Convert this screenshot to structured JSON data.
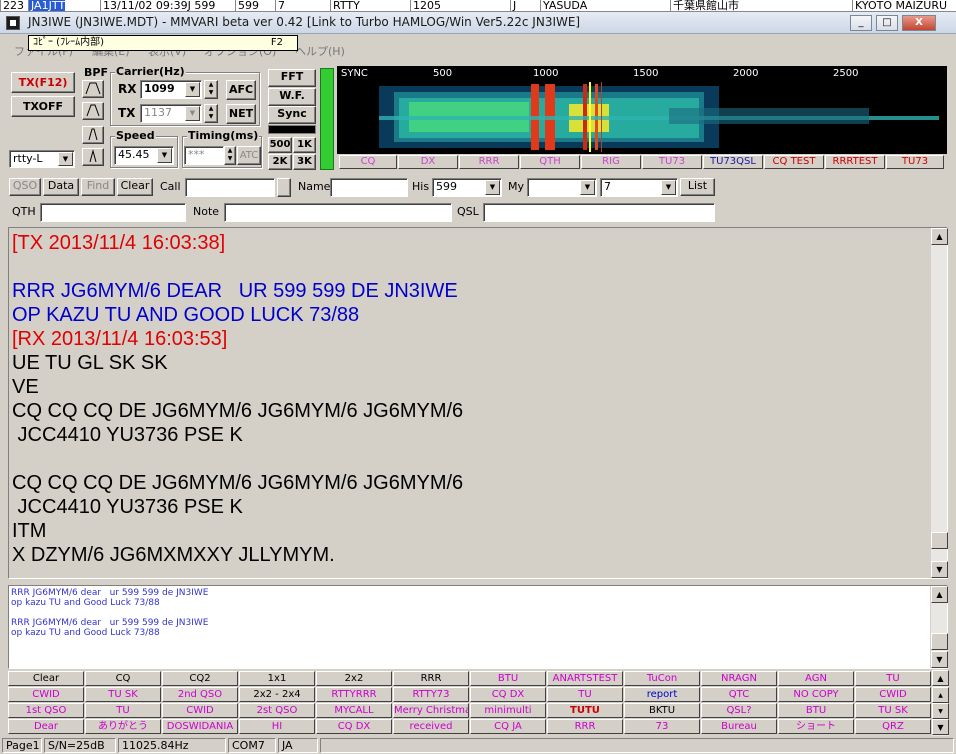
{
  "background_log": [
    "223",
    "JA1JTT",
    "13/11/02 09:39J 599",
    "599",
    "7",
    "RTTY",
    "1205",
    "J",
    "YASUDA",
    "千葉県館山市",
    "KYOTO MAIZURU"
  ],
  "window": {
    "title": "JN3IWE (JN3IWE.MDT) - MMVARI beta ver 0.42 [Link to Turbo HAMLOG/Win Ver5.22c JN3IWE]",
    "controls": [
      "_",
      "□",
      "X"
    ]
  },
  "menu": [
    "ファイル(F)",
    "編集(E)",
    "表示(V)",
    "オプション(O)",
    "ヘルプ(H)"
  ],
  "tooltip": {
    "text": "ｺﾋﾟｰ (ﾌﾚｰﾑ内部)",
    "key": "F2"
  },
  "left_panel": {
    "tx_button": "TX(F12)",
    "txoff_button": "TXOFF",
    "bpf_label": "BPF",
    "mode_value": "rtty-L",
    "carrier_label": "Carrier(Hz)",
    "rx_label": "RX",
    "rx_value": "1099",
    "tx_label": "TX",
    "tx_value": "1137",
    "afc_button": "AFC",
    "net_button": "NET",
    "speed_label": "Speed",
    "speed_value": "45.45",
    "timing_label": "Timing(ms)",
    "timing_value": "***",
    "atc_button": "ATC",
    "fft_button": "FFT",
    "wf_button": "W.F.",
    "sync_button": "Sync",
    "btn_500": "500",
    "btn_1k": "1K",
    "btn_2k": "2K",
    "btn_3k": "3K"
  },
  "waterfall": {
    "sync_label": "SYNC",
    "scale": [
      "500",
      "1000",
      "1500",
      "2000",
      "2500"
    ],
    "macros": [
      {
        "label": "CQ",
        "color": "#cc44cc"
      },
      {
        "label": "DX",
        "color": "#cc44cc"
      },
      {
        "label": "RRR",
        "color": "#cc44cc"
      },
      {
        "label": "QTH",
        "color": "#cc44cc"
      },
      {
        "label": "RIG",
        "color": "#cc44cc"
      },
      {
        "label": "TU73",
        "color": "#cc44cc"
      },
      {
        "label": "TU73QSL",
        "color": "#1a1aa0"
      },
      {
        "label": "CQ TEST",
        "color": "#cc0000"
      },
      {
        "label": "RRRTEST",
        "color": "#cc0000"
      },
      {
        "label": "TU73",
        "color": "#cc0000"
      }
    ]
  },
  "log_bar": {
    "qso_button": "QSO",
    "data_button": "Data",
    "find_button": "Find",
    "clear_button": "Clear",
    "call_label": "Call",
    "call_value": "",
    "name_label": "Name",
    "name_value": "",
    "his_label": "His",
    "his_value": "599",
    "my_label": "My",
    "my_value": "",
    "band_value": "7",
    "list_button": "List",
    "qth_label": "QTH",
    "note_label": "Note",
    "qsl_label": "QSL"
  },
  "rx_lines": [
    {
      "text": "[TX 2013/11/4 16:03:38]",
      "color": "#e00000"
    },
    {
      "text": "",
      "color": "#000000"
    },
    {
      "text": "RRR JG6MYM/6 DEAR   UR 599 599 DE JN3IWE",
      "color": "#0000cc"
    },
    {
      "text": "OP KAZU TU AND GOOD LUCK 73/88",
      "color": "#0000cc"
    },
    {
      "text": "[RX 2013/11/4 16:03:53]",
      "color": "#e00000"
    },
    {
      "text": "UE TU GL SK SK",
      "color": "#000000"
    },
    {
      "text": "VE",
      "color": "#000000"
    },
    {
      "text": "CQ CQ CQ DE JG6MYM/6 JG6MYM/6 JG6MYM/6",
      "color": "#000000"
    },
    {
      "text": " JCC4410 YU3736 PSE K",
      "color": "#000000"
    },
    {
      "text": "",
      "color": "#000000"
    },
    {
      "text": "CQ CQ CQ DE JG6MYM/6 JG6MYM/6 JG6MYM/6",
      "color": "#000000"
    },
    {
      "text": " JCC4410 YU3736 PSE K",
      "color": "#000000"
    },
    {
      "text": "ITM",
      "color": "#000000"
    },
    {
      "text": "X DZYM/6 JG6MXMXXY JLLYMYM.",
      "color": "#000000"
    }
  ],
  "tx_lines": [
    "RRR JG6MYM/6 dear   ur 599 599 de JN3IWE",
    "op kazu TU and Good Luck 73/88",
    "",
    "RRR JG6MYM/6 dear   ur 599 599 de JN3IWE",
    "op kazu TU and Good Luck 73/88"
  ],
  "macro_grid": [
    [
      {
        "l": "Clear",
        "c": "#000000"
      },
      {
        "l": "CQ",
        "c": "#000000"
      },
      {
        "l": "CQ2",
        "c": "#000000"
      },
      {
        "l": "1x1",
        "c": "#000000"
      },
      {
        "l": "2x2",
        "c": "#000000"
      },
      {
        "l": "RRR",
        "c": "#000000"
      },
      {
        "l": "BTU",
        "c": "#cc00cc"
      },
      {
        "l": "ANARTSTEST",
        "c": "#cc00cc"
      },
      {
        "l": "TuCon",
        "c": "#cc00cc"
      },
      {
        "l": "NRAGN",
        "c": "#cc00cc"
      },
      {
        "l": "AGN",
        "c": "#cc00cc"
      },
      {
        "l": "TU",
        "c": "#cc00cc"
      }
    ],
    [
      {
        "l": "CWID",
        "c": "#cc00cc"
      },
      {
        "l": "TU SK",
        "c": "#cc00cc"
      },
      {
        "l": "2nd QSO",
        "c": "#cc00cc"
      },
      {
        "l": "2x2 - 2x4",
        "c": "#000000"
      },
      {
        "l": "RTTYRRR",
        "c": "#cc00cc"
      },
      {
        "l": "RTTY73",
        "c": "#cc00cc"
      },
      {
        "l": "CQ DX",
        "c": "#cc00cc"
      },
      {
        "l": "TU",
        "c": "#cc00cc"
      },
      {
        "l": "report",
        "c": "#0000cc"
      },
      {
        "l": "QTC",
        "c": "#cc00cc"
      },
      {
        "l": "NO COPY",
        "c": "#cc00cc"
      },
      {
        "l": "CWID",
        "c": "#cc00cc"
      }
    ],
    [
      {
        "l": "1st QSO",
        "c": "#cc00cc"
      },
      {
        "l": "TU",
        "c": "#cc00cc"
      },
      {
        "l": "CWID",
        "c": "#cc00cc"
      },
      {
        "l": "2st QSO",
        "c": "#cc00cc"
      },
      {
        "l": "MYCALL",
        "c": "#cc00cc"
      },
      {
        "l": "Merry Christma",
        "c": "#cc00cc"
      },
      {
        "l": "minimulti",
        "c": "#cc00cc"
      },
      {
        "l": "TUTU",
        "c": "#cc0000"
      },
      {
        "l": "BKTU",
        "c": "#000000"
      },
      {
        "l": "QSL?",
        "c": "#cc00cc"
      },
      {
        "l": "BTU",
        "c": "#cc00cc"
      },
      {
        "l": "TU SK",
        "c": "#cc00cc"
      }
    ],
    [
      {
        "l": "Dear",
        "c": "#cc00cc"
      },
      {
        "l": "ありがとう",
        "c": "#cc00cc"
      },
      {
        "l": "DOSWIDANIA",
        "c": "#cc00cc"
      },
      {
        "l": "HI",
        "c": "#cc00cc"
      },
      {
        "l": "CQ DX",
        "c": "#cc00cc"
      },
      {
        "l": "received",
        "c": "#cc00cc"
      },
      {
        "l": "CQ JA",
        "c": "#cc00cc"
      },
      {
        "l": "RRR",
        "c": "#cc00cc"
      },
      {
        "l": "73",
        "c": "#cc00cc"
      },
      {
        "l": "Bureau",
        "c": "#cc00cc"
      },
      {
        "l": "ショート",
        "c": "#cc00cc"
      },
      {
        "l": "QRZ",
        "c": "#cc00cc"
      }
    ]
  ],
  "status": {
    "page": "Page1",
    "sn": "S/N=25dB",
    "clock": "11025.84Hz",
    "port": "COM7",
    "lang": "JA"
  },
  "colors": {
    "tx_red": "#cc0000",
    "rx_blue": "#0000cc",
    "macro_magenta": "#cc00cc",
    "sync_green": "#33cc33"
  }
}
